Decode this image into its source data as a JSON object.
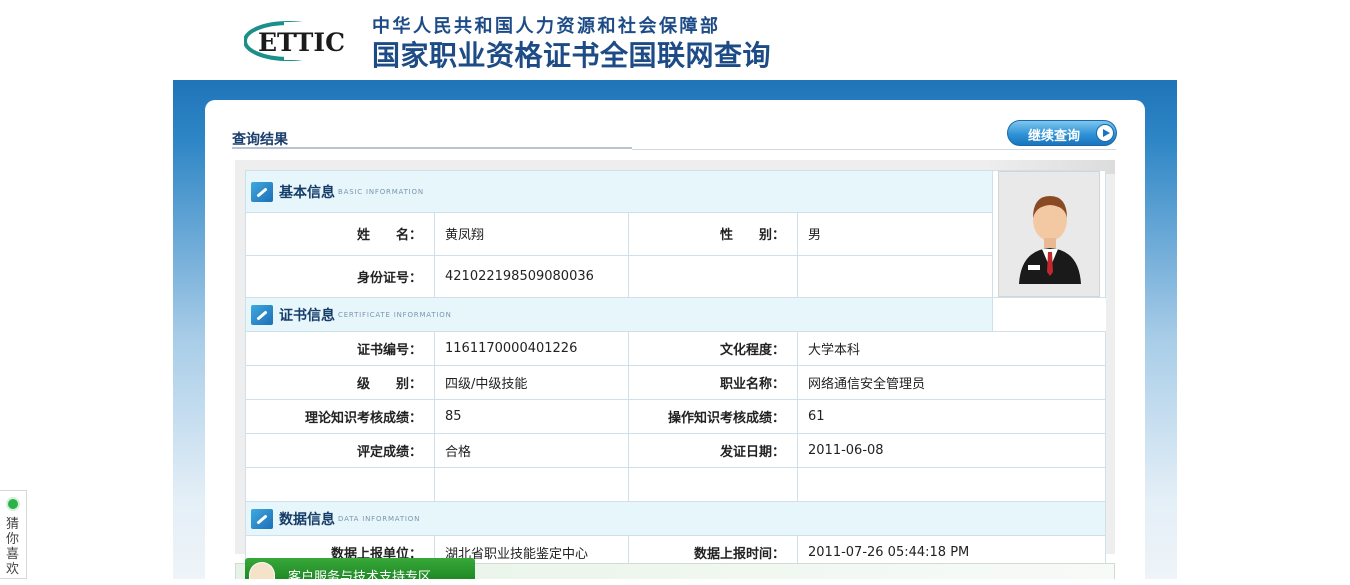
{
  "header": {
    "logo_text": "ETTIC",
    "ministry": "中华人民共和国人力资源和社会保障部",
    "system_title": "国家职业资格证书全国联网查询"
  },
  "results": {
    "title": "查询结果",
    "continue_button": "继续查询"
  },
  "sections": {
    "basic": {
      "title": "基本信息",
      "subtitle": "BASIC INFORMATION"
    },
    "certificate": {
      "title": "证书信息",
      "subtitle": "CERTIFICATE INFORMATION"
    },
    "data": {
      "title": "数据信息",
      "subtitle": "DATA INFORMATION"
    }
  },
  "basic": {
    "name_label": "姓　　名：",
    "name": "黄凤翔",
    "gender_label": "性　　别：",
    "gender": "男",
    "id_label": "身份证号：",
    "id_number": "421022198509080036"
  },
  "certificate": {
    "cert_no_label": "证书编号：",
    "cert_no": "1161170000401226",
    "education_label": "文化程度：",
    "education": "大学本科",
    "level_label": "级　　别：",
    "level": "四级/中级技能",
    "occupation_label": "职业名称：",
    "occupation": "网络通信安全管理员",
    "theory_label": "理论知识考核成绩：",
    "theory_score": "85",
    "practice_label": "操作知识考核成绩：",
    "practice_score": "61",
    "rating_label": "评定成绩：",
    "rating": "合格",
    "issue_date_label": "发证日期：",
    "issue_date": "2011-06-08"
  },
  "data_info": {
    "unit_label": "数据上报单位：",
    "unit": "湖北省职业技能鉴定中心",
    "time_label": "数据上报时间：",
    "time": "2011-07-26 05:44:18 PM"
  },
  "footer": {
    "support_label": "客户服务与技术支持专区"
  },
  "side_widget": {
    "label": "猜你喜欢"
  },
  "colors": {
    "brand_blue": "#1d4b86",
    "frame_blue": "#1f74b8",
    "section_bg": "#e7f6fb",
    "support_green": "#1f8a25"
  }
}
